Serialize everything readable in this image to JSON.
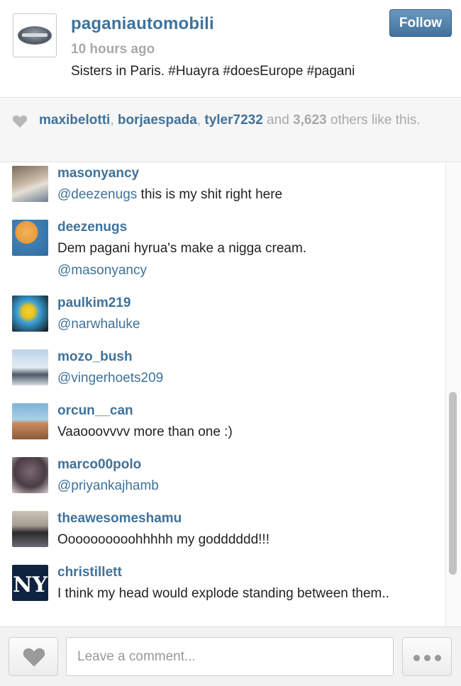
{
  "post": {
    "username": "paganiautomobili",
    "time": "10 hours ago",
    "caption": "Sisters in Paris. #Huayra #doesEurope #pagani",
    "follow_label": "Follow"
  },
  "likes": {
    "users": [
      "maxibelotti",
      "borjaespada",
      "tyler7232"
    ],
    "sep1": ", ",
    "sep2": ", ",
    "and_text": " and ",
    "count": "3,623",
    "others_text": " others like this."
  },
  "comments": [
    {
      "username": "masonyancy",
      "mention": "@deezenugs",
      "text": " this is my shit right here"
    },
    {
      "username": "deezenugs",
      "text": "Dem pagani hyrua's make a nigga cream.",
      "mention2": "@masonyancy"
    },
    {
      "username": "paulkim219",
      "mention": "@narwhaluke",
      "text": ""
    },
    {
      "username": "mozo_bush",
      "mention": "@vingerhoets209",
      "text": ""
    },
    {
      "username": "orcun__can",
      "text": "Vaaooovvvv more than one :)"
    },
    {
      "username": "marco00polo",
      "mention": "@priyankajhamb",
      "text": ""
    },
    {
      "username": "theawesomeshamu",
      "text": "Oooooooooohhhhh my godddddd!!!"
    },
    {
      "username": "christillett",
      "text": "I think my head would explode standing between them.."
    }
  ],
  "footer": {
    "comment_placeholder": "Leave a comment..."
  },
  "icons": {
    "like": "heart-icon",
    "more": "ellipsis-icon"
  },
  "colors": {
    "link": "#3f729b",
    "follow_button": "#3f729b",
    "muted": "#a9a9a9"
  }
}
